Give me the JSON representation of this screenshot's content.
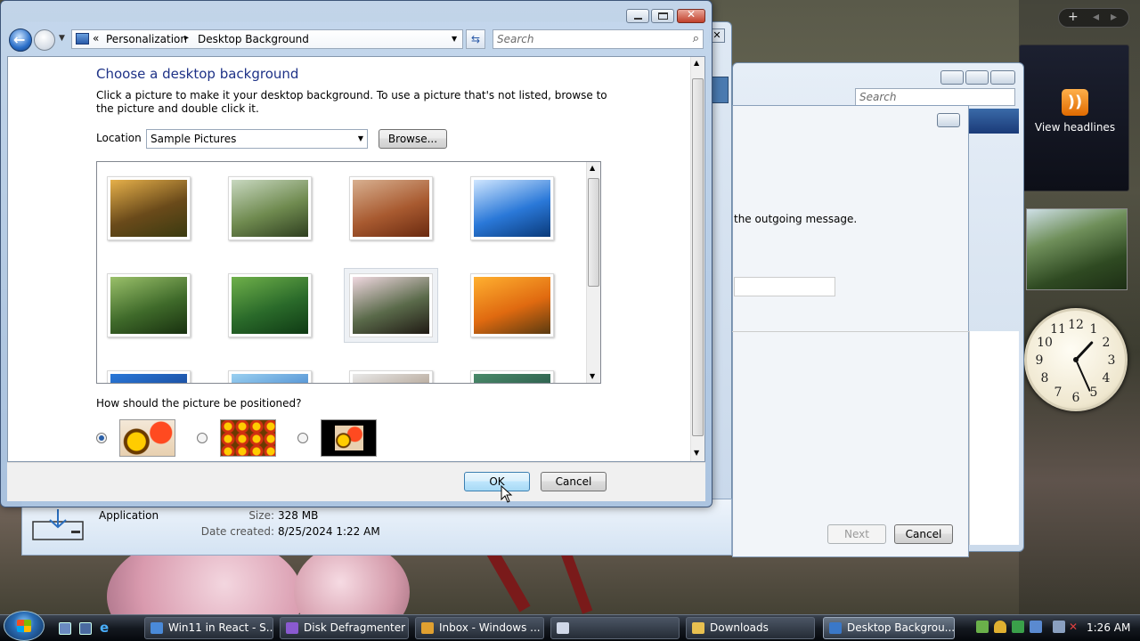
{
  "dialog": {
    "breadcrumb_prefix": "«",
    "breadcrumb_1": "Personalization",
    "breadcrumb_sep": "▸",
    "breadcrumb_2": "Desktop Background",
    "search_placeholder": "Search",
    "heading": "Choose a desktop background",
    "description": "Click a picture to make it your desktop background. To use a picture that's not listed, browse to the picture and double click it.",
    "location_label": "Location",
    "location_value": "Sample Pictures",
    "browse_label": "Browse...",
    "position_question": "How should the picture be positioned?",
    "position_selected": "fit",
    "ok_label": "OK",
    "cancel_label": "Cancel"
  },
  "thumbnails": [
    {
      "name": "autumn-leaves",
      "colors": [
        "#e6b04a",
        "#6a4a1a",
        "#3a3a10"
      ]
    },
    {
      "name": "creek",
      "colors": [
        "#c8d8c0",
        "#6f8a4f",
        "#2f3f20"
      ]
    },
    {
      "name": "desert-landscape",
      "colors": [
        "#d8b090",
        "#a85a30",
        "#6a2a10"
      ]
    },
    {
      "name": "oryx-antelope",
      "colors": [
        "#cfe6ff",
        "#2a78d8",
        "#0a3a7a"
      ]
    },
    {
      "name": "forest",
      "colors": [
        "#9ac06a",
        "#3f6a2a",
        "#18300f"
      ]
    },
    {
      "name": "green-sea-turtle",
      "colors": [
        "#6fb04a",
        "#2a6a2a",
        "#0f3a14"
      ]
    },
    {
      "name": "frangipani-flowers",
      "colors": [
        "#f0d8e0",
        "#5a6a4a",
        "#201a14"
      ]
    },
    {
      "name": "garden",
      "colors": [
        "#ffb030",
        "#e06a10",
        "#5a3a10"
      ]
    },
    {
      "name": "row3-a",
      "colors": [
        "#2a78d8",
        "#1a4a9a",
        "#0a2a5a"
      ]
    },
    {
      "name": "row3-b",
      "colors": [
        "#9ad0f0",
        "#4a8ad0",
        "#2a5a9a"
      ]
    },
    {
      "name": "row3-c",
      "colors": [
        "#e8e8e8",
        "#b0a090",
        "#806050"
      ]
    },
    {
      "name": "row3-d",
      "colors": [
        "#4a8a6a",
        "#2a5a4a",
        "#103020"
      ]
    }
  ],
  "background_window": {
    "details_type": "Application",
    "size_label": "Size:",
    "size_value": "328 MB",
    "date_label": "Date created:",
    "date_value": "8/25/2024 1:22 AM"
  },
  "email_window": {
    "search_placeholder": "Search",
    "text_fragment": "the outgoing message.",
    "next_label": "Next",
    "cancel_label": "Cancel"
  },
  "sidebar": {
    "add_label": "+",
    "feed_label": "View headlines"
  },
  "clock": {
    "hour": 1,
    "minute": 26
  },
  "taskbar": {
    "items": [
      {
        "label": "Win11 in React - S...",
        "icon_color": "#4a8ad8"
      },
      {
        "label": "Disk Defragmenter",
        "icon_color": "#8a5ad0"
      },
      {
        "label": "Inbox - Windows ...",
        "icon_color": "#e0a030"
      },
      {
        "label": "",
        "icon_color": "#d0d8e8"
      },
      {
        "label": "Downloads",
        "icon_color": "#e8c050"
      },
      {
        "label": "Desktop Backgrou...",
        "icon_color": "#3a78c8"
      }
    ],
    "time": "1:26 AM"
  }
}
